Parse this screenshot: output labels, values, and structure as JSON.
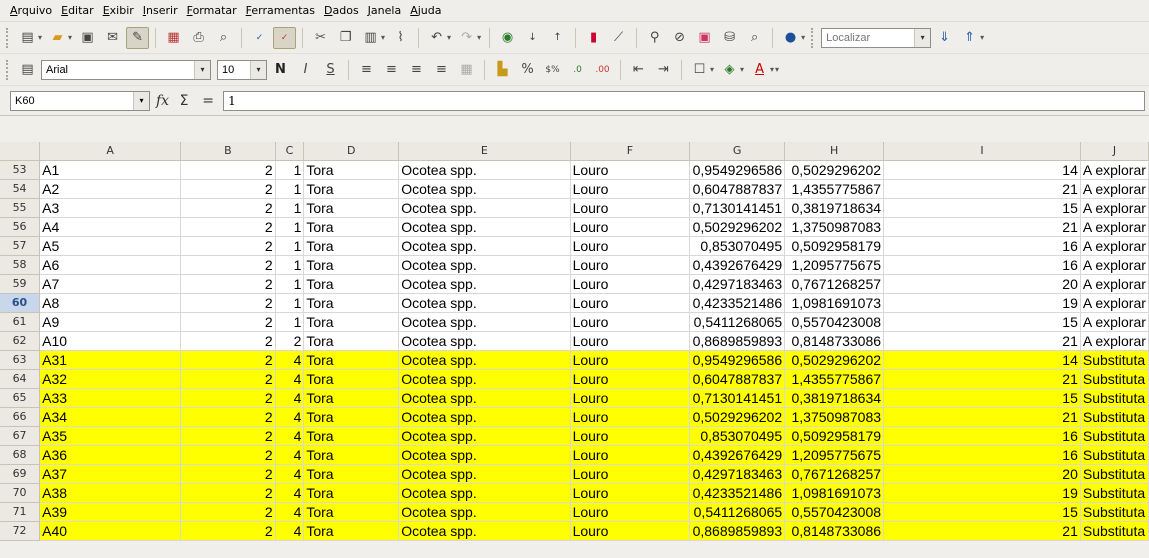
{
  "menu": [
    "Arquivo",
    "Editar",
    "Exibir",
    "Inserir",
    "Formatar",
    "Ferramentas",
    "Dados",
    "Janela",
    "Ajuda"
  ],
  "toolbar": {
    "search_placeholder": "Localizar"
  },
  "format_bar": {
    "font_name": "Arial",
    "font_size": "10"
  },
  "formula_bar": {
    "cell_ref": "K60",
    "content": "1"
  },
  "columns": [
    "A",
    "B",
    "C",
    "D",
    "E",
    "F",
    "G",
    "H",
    "I",
    "J"
  ],
  "rows": [
    {
      "n": "53",
      "a": "A1",
      "b": "2",
      "c": "1",
      "d": "Tora",
      "e": "Ocotea spp.",
      "f": "Louro",
      "g": "0,9549296586",
      "h": "0,5029296202",
      "i": "14",
      "j": "A explorar",
      "hl": false
    },
    {
      "n": "54",
      "a": "A2",
      "b": "2",
      "c": "1",
      "d": "Tora",
      "e": "Ocotea spp.",
      "f": "Louro",
      "g": "0,6047887837",
      "h": "1,4355775867",
      "i": "21",
      "j": "A explorar",
      "hl": false
    },
    {
      "n": "55",
      "a": "A3",
      "b": "2",
      "c": "1",
      "d": "Tora",
      "e": "Ocotea spp.",
      "f": "Louro",
      "g": "0,7130141451",
      "h": "0,3819718634",
      "i": "15",
      "j": "A explorar",
      "hl": false
    },
    {
      "n": "56",
      "a": "A4",
      "b": "2",
      "c": "1",
      "d": "Tora",
      "e": "Ocotea spp.",
      "f": "Louro",
      "g": "0,5029296202",
      "h": "1,3750987083",
      "i": "21",
      "j": "A explorar",
      "hl": false
    },
    {
      "n": "57",
      "a": "A5",
      "b": "2",
      "c": "1",
      "d": "Tora",
      "e": "Ocotea spp.",
      "f": "Louro",
      "g": "0,853070495",
      "h": "0,5092958179",
      "i": "16",
      "j": "A explorar",
      "hl": false
    },
    {
      "n": "58",
      "a": "A6",
      "b": "2",
      "c": "1",
      "d": "Tora",
      "e": "Ocotea spp.",
      "f": "Louro",
      "g": "0,4392676429",
      "h": "1,2095775675",
      "i": "16",
      "j": "A explorar",
      "hl": false
    },
    {
      "n": "59",
      "a": "A7",
      "b": "2",
      "c": "1",
      "d": "Tora",
      "e": "Ocotea spp.",
      "f": "Louro",
      "g": "0,4297183463",
      "h": "0,7671268257",
      "i": "20",
      "j": "A explorar",
      "hl": false
    },
    {
      "n": "60",
      "a": "A8",
      "b": "2",
      "c": "1",
      "d": "Tora",
      "e": "Ocotea spp.",
      "f": "Louro",
      "g": "0,4233521486",
      "h": "1,0981691073",
      "i": "19",
      "j": "A explorar",
      "hl": false,
      "sel": true
    },
    {
      "n": "61",
      "a": "A9",
      "b": "2",
      "c": "1",
      "d": "Tora",
      "e": "Ocotea spp.",
      "f": "Louro",
      "g": "0,5411268065",
      "h": "0,5570423008",
      "i": "15",
      "j": "A explorar",
      "hl": false
    },
    {
      "n": "62",
      "a": "A10",
      "b": "2",
      "c": "2",
      "d": "Tora",
      "e": "Ocotea spp.",
      "f": "Louro",
      "g": "0,8689859893",
      "h": "0,8148733086",
      "i": "21",
      "j": "A explorar",
      "hl": false
    },
    {
      "n": "63",
      "a": "A31",
      "b": "2",
      "c": "4",
      "d": "Tora",
      "e": "Ocotea spp.",
      "f": "Louro",
      "g": "0,9549296586",
      "h": "0,5029296202",
      "i": "14",
      "j": "Substituta",
      "hl": true
    },
    {
      "n": "64",
      "a": "A32",
      "b": "2",
      "c": "4",
      "d": "Tora",
      "e": "Ocotea spp.",
      "f": "Louro",
      "g": "0,6047887837",
      "h": "1,4355775867",
      "i": "21",
      "j": "Substituta",
      "hl": true
    },
    {
      "n": "65",
      "a": "A33",
      "b": "2",
      "c": "4",
      "d": "Tora",
      "e": "Ocotea spp.",
      "f": "Louro",
      "g": "0,7130141451",
      "h": "0,3819718634",
      "i": "15",
      "j": "Substituta",
      "hl": true
    },
    {
      "n": "66",
      "a": "A34",
      "b": "2",
      "c": "4",
      "d": "Tora",
      "e": "Ocotea spp.",
      "f": "Louro",
      "g": "0,5029296202",
      "h": "1,3750987083",
      "i": "21",
      "j": "Substituta",
      "hl": true
    },
    {
      "n": "67",
      "a": "A35",
      "b": "2",
      "c": "4",
      "d": "Tora",
      "e": "Ocotea spp.",
      "f": "Louro",
      "g": "0,853070495",
      "h": "0,5092958179",
      "i": "16",
      "j": "Substituta",
      "hl": true
    },
    {
      "n": "68",
      "a": "A36",
      "b": "2",
      "c": "4",
      "d": "Tora",
      "e": "Ocotea spp.",
      "f": "Louro",
      "g": "0,4392676429",
      "h": "1,2095775675",
      "i": "16",
      "j": "Substituta",
      "hl": true
    },
    {
      "n": "69",
      "a": "A37",
      "b": "2",
      "c": "4",
      "d": "Tora",
      "e": "Ocotea spp.",
      "f": "Louro",
      "g": "0,4297183463",
      "h": "0,7671268257",
      "i": "20",
      "j": "Substituta",
      "hl": true
    },
    {
      "n": "70",
      "a": "A38",
      "b": "2",
      "c": "4",
      "d": "Tora",
      "e": "Ocotea spp.",
      "f": "Louro",
      "g": "0,4233521486",
      "h": "1,0981691073",
      "i": "19",
      "j": "Substituta",
      "hl": true
    },
    {
      "n": "71",
      "a": "A39",
      "b": "2",
      "c": "4",
      "d": "Tora",
      "e": "Ocotea spp.",
      "f": "Louro",
      "g": "0,5411268065",
      "h": "0,5570423008",
      "i": "15",
      "j": "Substituta",
      "hl": true
    },
    {
      "n": "72",
      "a": "A40",
      "b": "2",
      "c": "4",
      "d": "Tora",
      "e": "Ocotea spp.",
      "f": "Louro",
      "g": "0,8689859893",
      "h": "0,8148733086",
      "i": "21",
      "j": "Substituta",
      "hl": true
    }
  ],
  "colors": {
    "highlight": "#ffff00",
    "selected_row_header": "#c9d7ec"
  }
}
